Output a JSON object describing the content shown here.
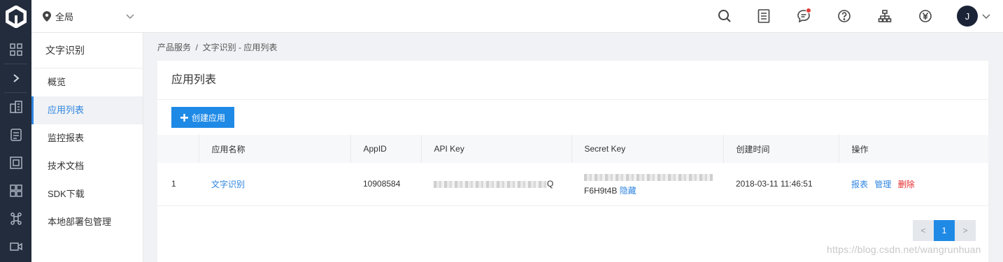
{
  "rail": {
    "icons": [
      "logo-icon",
      "grid-icon",
      "expand-icon",
      "building-icon",
      "document-icon",
      "frame-icon",
      "apps-icon",
      "command-icon",
      "video-icon"
    ]
  },
  "topbar": {
    "region_label": "全局",
    "avatar_initial": "J",
    "icons": [
      "search-icon",
      "list-icon",
      "message-icon",
      "help-icon",
      "sitemap-icon",
      "yen-icon"
    ]
  },
  "sidebar": {
    "title": "文字识别",
    "items": [
      {
        "label": "概览",
        "active": false
      },
      {
        "label": "应用列表",
        "active": true
      },
      {
        "label": "监控报表",
        "active": false
      },
      {
        "label": "技术文档",
        "active": false
      },
      {
        "label": "SDK下载",
        "active": false
      },
      {
        "label": "本地部署包管理",
        "active": false
      }
    ]
  },
  "breadcrumb": "产品服务  /  文字识别 - 应用列表",
  "main": {
    "title": "应用列表",
    "create_button": "创建应用",
    "table": {
      "headers": [
        "",
        "应用名称",
        "AppID",
        "API Key",
        "Secret Key",
        "创建时间",
        "操作"
      ],
      "rows": [
        {
          "index": "1",
          "name": "文字识别",
          "appid": "10908584",
          "api_key_suffix": "Q",
          "secret_key_tail": "F6H9t4B",
          "secret_toggle": "隐藏",
          "created": "2018-03-11 11:46:51",
          "actions": {
            "report": "报表",
            "manage": "管理",
            "delete": "删除"
          }
        }
      ]
    },
    "pagination": {
      "prev": "<",
      "current": "1",
      "next": ">"
    }
  },
  "watermark": "https://blog.csdn.net/wangrunhuan",
  "colors": {
    "accent": "#1f8ae6",
    "rail": "#232c3c",
    "danger": "#e32a2a"
  }
}
